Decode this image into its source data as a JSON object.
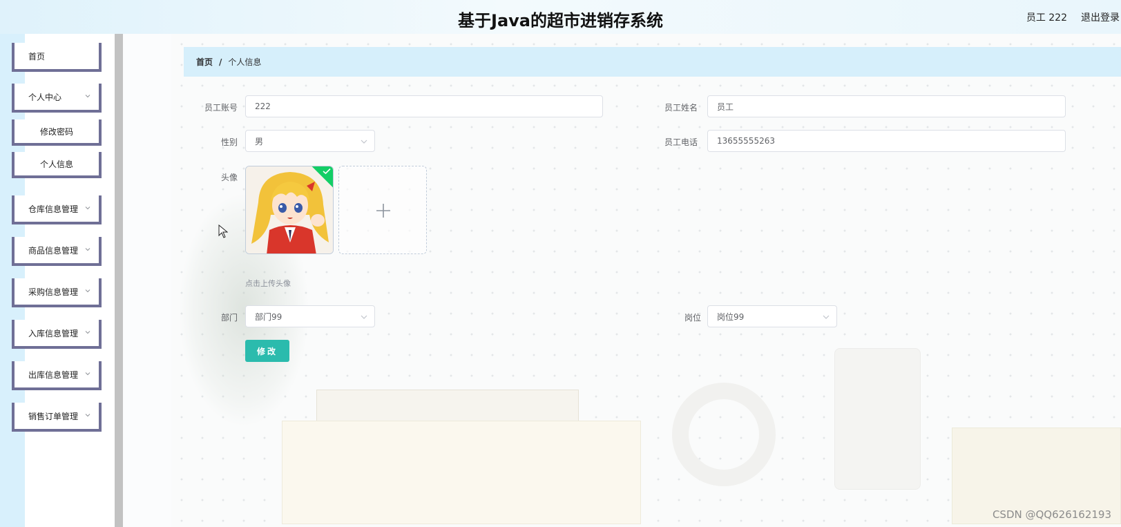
{
  "header": {
    "title": "基于Java的超市进销存系统",
    "user_label": "员工 222",
    "logout_label": "退出登录"
  },
  "sidebar": {
    "items": [
      {
        "label": "首页",
        "has_chevron": false
      },
      {
        "label": "个人中心",
        "has_chevron": true
      },
      {
        "label": "修改密码",
        "sub": true
      },
      {
        "label": "个人信息",
        "sub": true
      },
      {
        "label": "仓库信息管理",
        "has_chevron": true
      },
      {
        "label": "商品信息管理",
        "has_chevron": true
      },
      {
        "label": "采购信息管理",
        "has_chevron": true
      },
      {
        "label": "入库信息管理",
        "has_chevron": true
      },
      {
        "label": "出库信息管理",
        "has_chevron": true
      },
      {
        "label": "销售订单管理",
        "has_chevron": true
      }
    ]
  },
  "breadcrumb": {
    "home": "首页",
    "separator": "/",
    "current": "个人信息"
  },
  "form": {
    "account": {
      "label": "员工账号",
      "value": "222"
    },
    "name": {
      "label": "员工姓名",
      "value": "员工"
    },
    "gender": {
      "label": "性别",
      "value": "男"
    },
    "phone": {
      "label": "员工电话",
      "value": "13655555263"
    },
    "avatar": {
      "label": "头像",
      "tip": "点击上传头像"
    },
    "department": {
      "label": "部门",
      "value": "部门99"
    },
    "position": {
      "label": "岗位",
      "value": "岗位99"
    },
    "submit_label": "修改"
  },
  "watermark": "CSDN @QQ626162193",
  "colors": {
    "accent": "#2bbbad",
    "breadcrumb_bg": "#d6effb",
    "sidebar_border": "#6f6f96",
    "success_badge": "#13ce66"
  },
  "icons": [
    "chevron-down-icon",
    "plus-icon",
    "check-icon",
    "cursor-icon"
  ]
}
